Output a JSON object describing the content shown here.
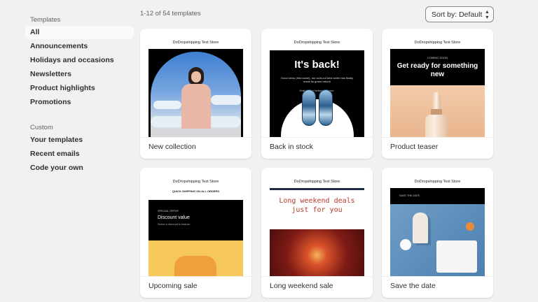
{
  "sidebar": {
    "heading_templates": "Templates",
    "items": [
      {
        "label": "All"
      },
      {
        "label": "Announcements"
      },
      {
        "label": "Holidays and occasions"
      },
      {
        "label": "Newsletters"
      },
      {
        "label": "Product highlights"
      },
      {
        "label": "Promotions"
      }
    ],
    "heading_custom": "Custom",
    "custom_items": [
      {
        "label": "Your templates"
      },
      {
        "label": "Recent emails"
      },
      {
        "label": "Code your own"
      }
    ]
  },
  "toolbar": {
    "count": "1-12 of 54 templates",
    "sort_label": "Sort by: Default",
    "sort_icon": "chevron-up-down-icon"
  },
  "cards": [
    {
      "label": "New collection",
      "store": "DoDropshipping Test Store"
    },
    {
      "label": "Back in stock",
      "store": "DoDropshipping Test Store",
      "headline": "It's back!",
      "body": "Good news (first name), our sold-out best seller has finally made its grand return!",
      "sub": "Grab a new before it's gone."
    },
    {
      "label": "Product teaser",
      "store": "DoDropshipping Test Store",
      "small": "COMING SOON",
      "headline": "Get ready for something new"
    },
    {
      "label": "Upcoming sale",
      "store": "DoDropshipping Test Store",
      "shipping": "QUICK SHIPPING ON ALL ORDERS",
      "special": "SPECIAL OFFER",
      "discount": "Discount value",
      "select": "Select a discount to feature."
    },
    {
      "label": "Long weekend sale",
      "store": "DoDropshipping Test Store",
      "headline": "Long weekend deals just for you"
    },
    {
      "label": "Save the date",
      "store": "DoDropshipping Test Store",
      "std": "SAVE THE DATE"
    }
  ]
}
